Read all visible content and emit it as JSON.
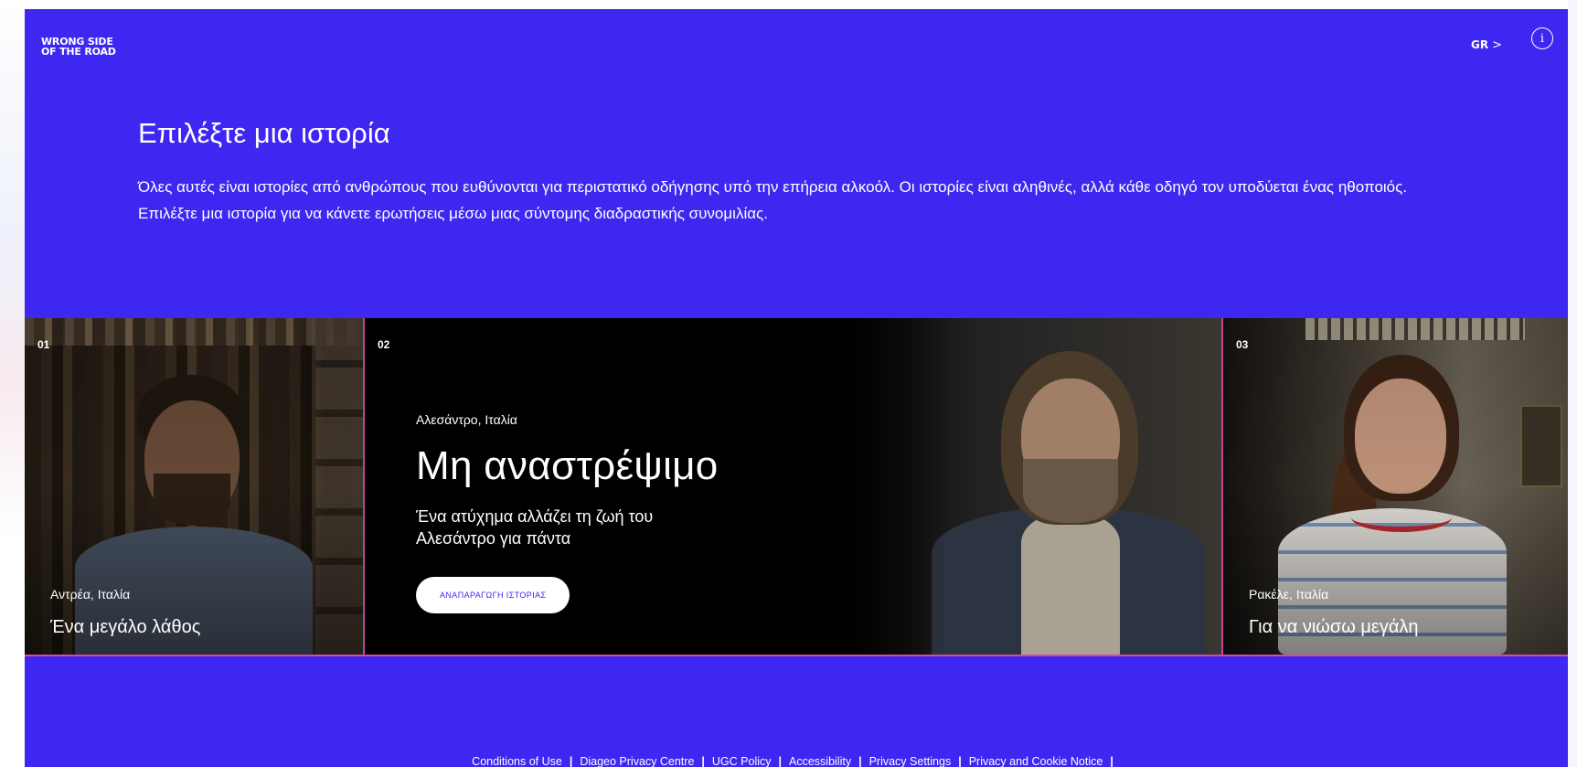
{
  "brand": {
    "logo_line1": "WRONG SIDE",
    "logo_line2": "OF THE ROAD"
  },
  "header": {
    "language": "GR",
    "language_chevron": ">",
    "info_glyph": "i"
  },
  "intro": {
    "heading": "Επιλέξτε μια ιστορία",
    "line1": "Όλες αυτές είναι ιστορίες από ανθρώπους που ευθύνονται για περιστατικό οδήγησης υπό την επήρεια αλκοόλ. Οι ιστορίες είναι αληθινές, αλλά κάθε οδηγό τον υποδύεται ένας ηθοποιός.",
    "line2": "Επιλέξτε μια ιστορία για να κάνετε ερωτήσεις μέσω μιας σύντομης διαδραστικής συνομιλίας."
  },
  "stories": [
    {
      "number": "01",
      "place": "Αντρέα, Ιταλία",
      "title": "Ένα μεγάλο λάθος"
    },
    {
      "number": "02",
      "place": "Αλεσάντρο, Ιταλία",
      "title": "Μη αναστρέψιμο",
      "description_line1": "Ένα ατύχημα αλλάζει τη ζωή του",
      "description_line2": "Αλεσάντρο για πάντα",
      "button_label": "ΑΝΑΠΑΡΑΓΩΓΗ ΙΣΤΟΡΙΑΣ"
    },
    {
      "number": "03",
      "place": "Ρακέλε, Ιταλία",
      "title": "Για να νιώσω μεγάλη"
    }
  ],
  "footer": {
    "separator": "|",
    "links": [
      "Conditions of Use",
      "Diageo Privacy Centre",
      "UGC Policy",
      "Accessibility",
      "Privacy Settings",
      "Privacy and Cookie Notice"
    ]
  },
  "colors": {
    "brand_blue": "#3f27f2",
    "card_divider": "#c4419a",
    "text": "#ffffff"
  }
}
